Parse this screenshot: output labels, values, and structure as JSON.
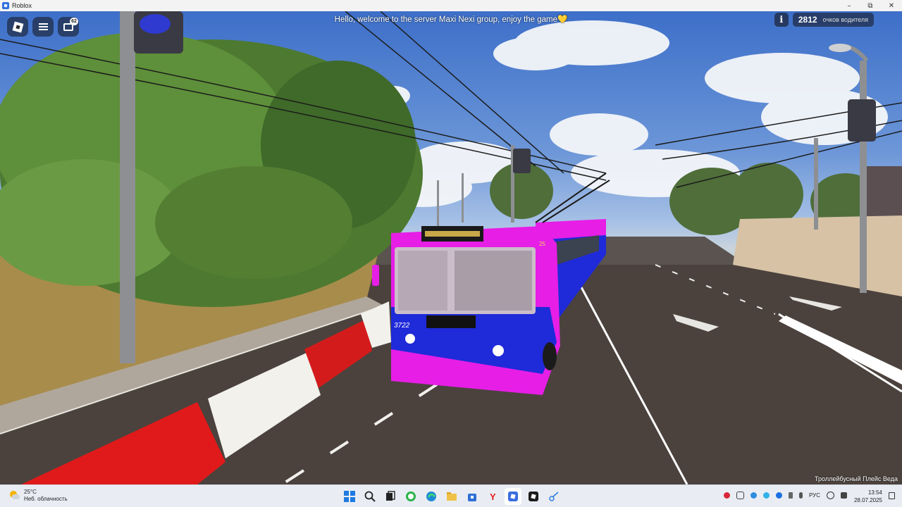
{
  "window": {
    "title": "Roblox",
    "minimize_glyph": "–",
    "maximize_glyph": "⧉",
    "close_glyph": "✕"
  },
  "hud": {
    "server_message": "Hello, welcome to the server Maxi Nexi group, enjoy the game💛",
    "chat_badge": "62",
    "info_glyph": "i",
    "score_value": "2812",
    "score_label": "очков водителя",
    "location": "Троллейбусный Плейс Веда"
  },
  "scene": {
    "bus_number": "3722",
    "route_number": "25"
  },
  "taskbar": {
    "weather_temp": "25°C",
    "weather_desc": "Неб. облачность",
    "apps": [
      {
        "name": "windows-start-icon"
      },
      {
        "name": "search-icon"
      },
      {
        "name": "task-view-icon"
      },
      {
        "name": "whatsapp-icon"
      },
      {
        "name": "edge-icon"
      },
      {
        "name": "file-explorer-icon"
      },
      {
        "name": "store-icon"
      },
      {
        "name": "yandex-icon"
      },
      {
        "name": "roblox-icon"
      },
      {
        "name": "roblox-studio-icon"
      },
      {
        "name": "snipping-tool-icon"
      }
    ],
    "language": "РУС",
    "time": "13:54",
    "date": "28.07.2025"
  },
  "colors": {
    "bus_magenta": "#e61ee6",
    "bus_blue": "#1f2ad8",
    "taskbar_bg": "#e9edf3",
    "barrier_red": "#e01a1a"
  }
}
